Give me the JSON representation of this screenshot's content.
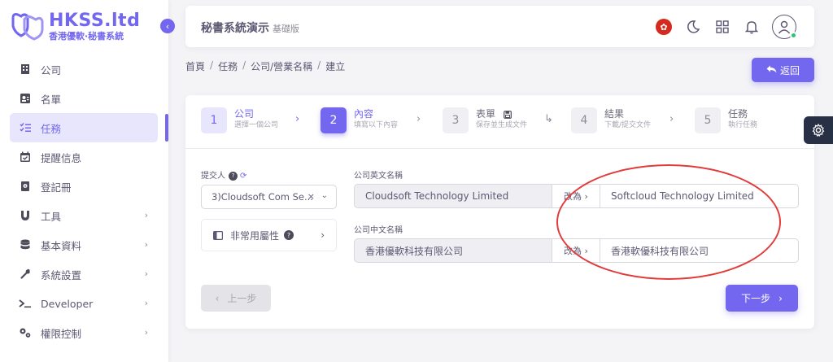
{
  "brand": {
    "title": "HKSS.ltd",
    "subtitle": "香港優軟·秘書系統",
    "accent": "#7367f0"
  },
  "sidebar": {
    "items": [
      {
        "label": "公司",
        "icon": "building-icon",
        "has_children": false,
        "active": false
      },
      {
        "label": "名單",
        "icon": "contact-card-icon",
        "has_children": false,
        "active": false
      },
      {
        "label": "任務",
        "icon": "checklist-icon",
        "has_children": false,
        "active": true
      },
      {
        "label": "提醒信息",
        "icon": "calendar-icon",
        "has_children": false,
        "active": false
      },
      {
        "label": "登記冊",
        "icon": "register-book-icon",
        "has_children": false,
        "active": false
      },
      {
        "label": "工具",
        "icon": "magnet-icon",
        "has_children": true,
        "active": false
      },
      {
        "label": "基本資料",
        "icon": "database-icon",
        "has_children": true,
        "active": false
      },
      {
        "label": "系統設置",
        "icon": "wrench-icon",
        "has_children": true,
        "active": false
      },
      {
        "label": "Developer",
        "icon": "terminal-icon",
        "has_children": true,
        "active": false
      },
      {
        "label": "權限控制",
        "icon": "gears-icon",
        "has_children": true,
        "active": false
      }
    ]
  },
  "header": {
    "app_title": "秘書系統演示",
    "edition": "基礎版"
  },
  "breadcrumb": [
    "首頁",
    "任務",
    "公司/營業名稱",
    "建立"
  ],
  "back_button": "返回",
  "stepper": [
    {
      "num": "1",
      "title": "公司",
      "sub": "選擇一個公司",
      "state": "done"
    },
    {
      "num": "2",
      "title": "內容",
      "sub": "填寫以下內容",
      "state": "active"
    },
    {
      "num": "3",
      "title": "表單",
      "sub": "保存並生成文件",
      "state": "pending"
    },
    {
      "num": "4",
      "title": "結果",
      "sub": "下載/提交文件",
      "state": "pending"
    },
    {
      "num": "5",
      "title": "任務",
      "sub": "執行任務",
      "state": "pending"
    }
  ],
  "form": {
    "submitter_label": "提交人",
    "submitter_value": "3)Cloudsoft Com Se...",
    "uncommon_attrs_label": "非常用屬性",
    "en_name_label": "公司英文名稱",
    "en_name_current": "Cloudsoft Technology Limited",
    "en_name_change_label": "改為",
    "en_name_new": "Softcloud Technology Limited",
    "zh_name_label": "公司中文名稱",
    "zh_name_current": "香港優軟科技有限公司",
    "zh_name_change_label": "改為",
    "zh_name_new": "香港軟優科技有限公司"
  },
  "buttons": {
    "prev": "上一步",
    "next": "下一步"
  },
  "colors": {
    "primary": "#7367f0",
    "annotation": "#e23b3b",
    "dark": "#283046"
  }
}
